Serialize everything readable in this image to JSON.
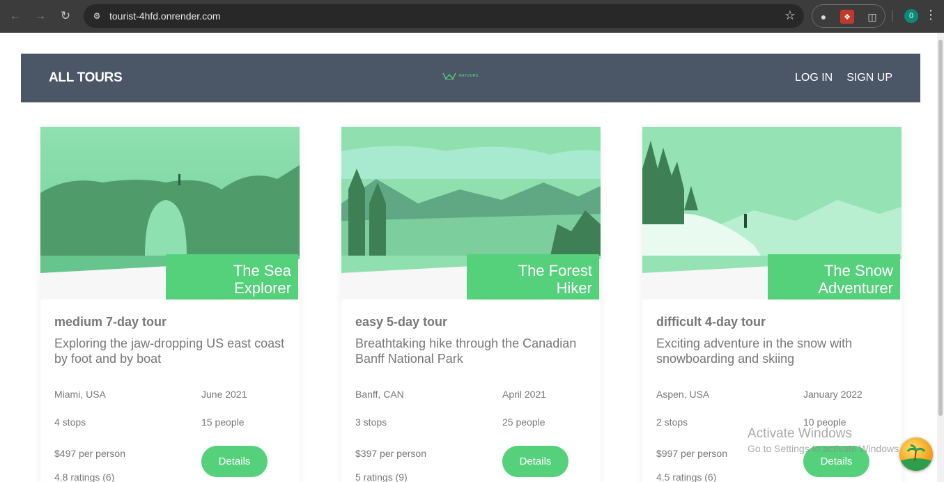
{
  "browser": {
    "url": "tourist-4hfd.onrender.com",
    "profile_initial": "0"
  },
  "header": {
    "all_tours": "ALL TOURS",
    "logo_text": "NATOURS",
    "login": "LOG IN",
    "signup": "SIGN UP"
  },
  "tours": [
    {
      "name_line1": "The Sea",
      "name_line2": "Explorer",
      "subtitle": "medium 7-day tour",
      "summary": "Exploring the jaw-dropping US east coast by foot and by boat",
      "location": "Miami, USA",
      "date": "June 2021",
      "stops": "4 stops",
      "people": "15 people",
      "price": "$497",
      "price_unit": "per person",
      "ratings": "4.8 ratings (6)",
      "button": "Details"
    },
    {
      "name_line1": "The Forest",
      "name_line2": "Hiker",
      "subtitle": "easy 5-day tour",
      "summary": "Breathtaking hike through the Canadian Banff National Park",
      "location": "Banff, CAN",
      "date": "April 2021",
      "stops": "3 stops",
      "people": "25 people",
      "price": "$397",
      "price_unit": "per person",
      "ratings": "5 ratings (9)",
      "button": "Details"
    },
    {
      "name_line1": "The Snow",
      "name_line2": "Adventurer",
      "subtitle": "difficult 4-day tour",
      "summary": "Exciting adventure in the snow with snowboarding and skiing",
      "location": "Aspen, USA",
      "date": "January 2022",
      "stops": "2 stops",
      "people": "10 people",
      "price": "$997",
      "price_unit": "per person",
      "ratings": "4.5 ratings (6)",
      "button": "Details"
    }
  ],
  "os_overlay": {
    "title": "Activate Windows",
    "subtitle": "Go to Settings to activate Windows."
  },
  "colors": {
    "accent": "#55d17c",
    "header_bg": "#4b5667",
    "chrome_bg": "#3c3c3c"
  }
}
